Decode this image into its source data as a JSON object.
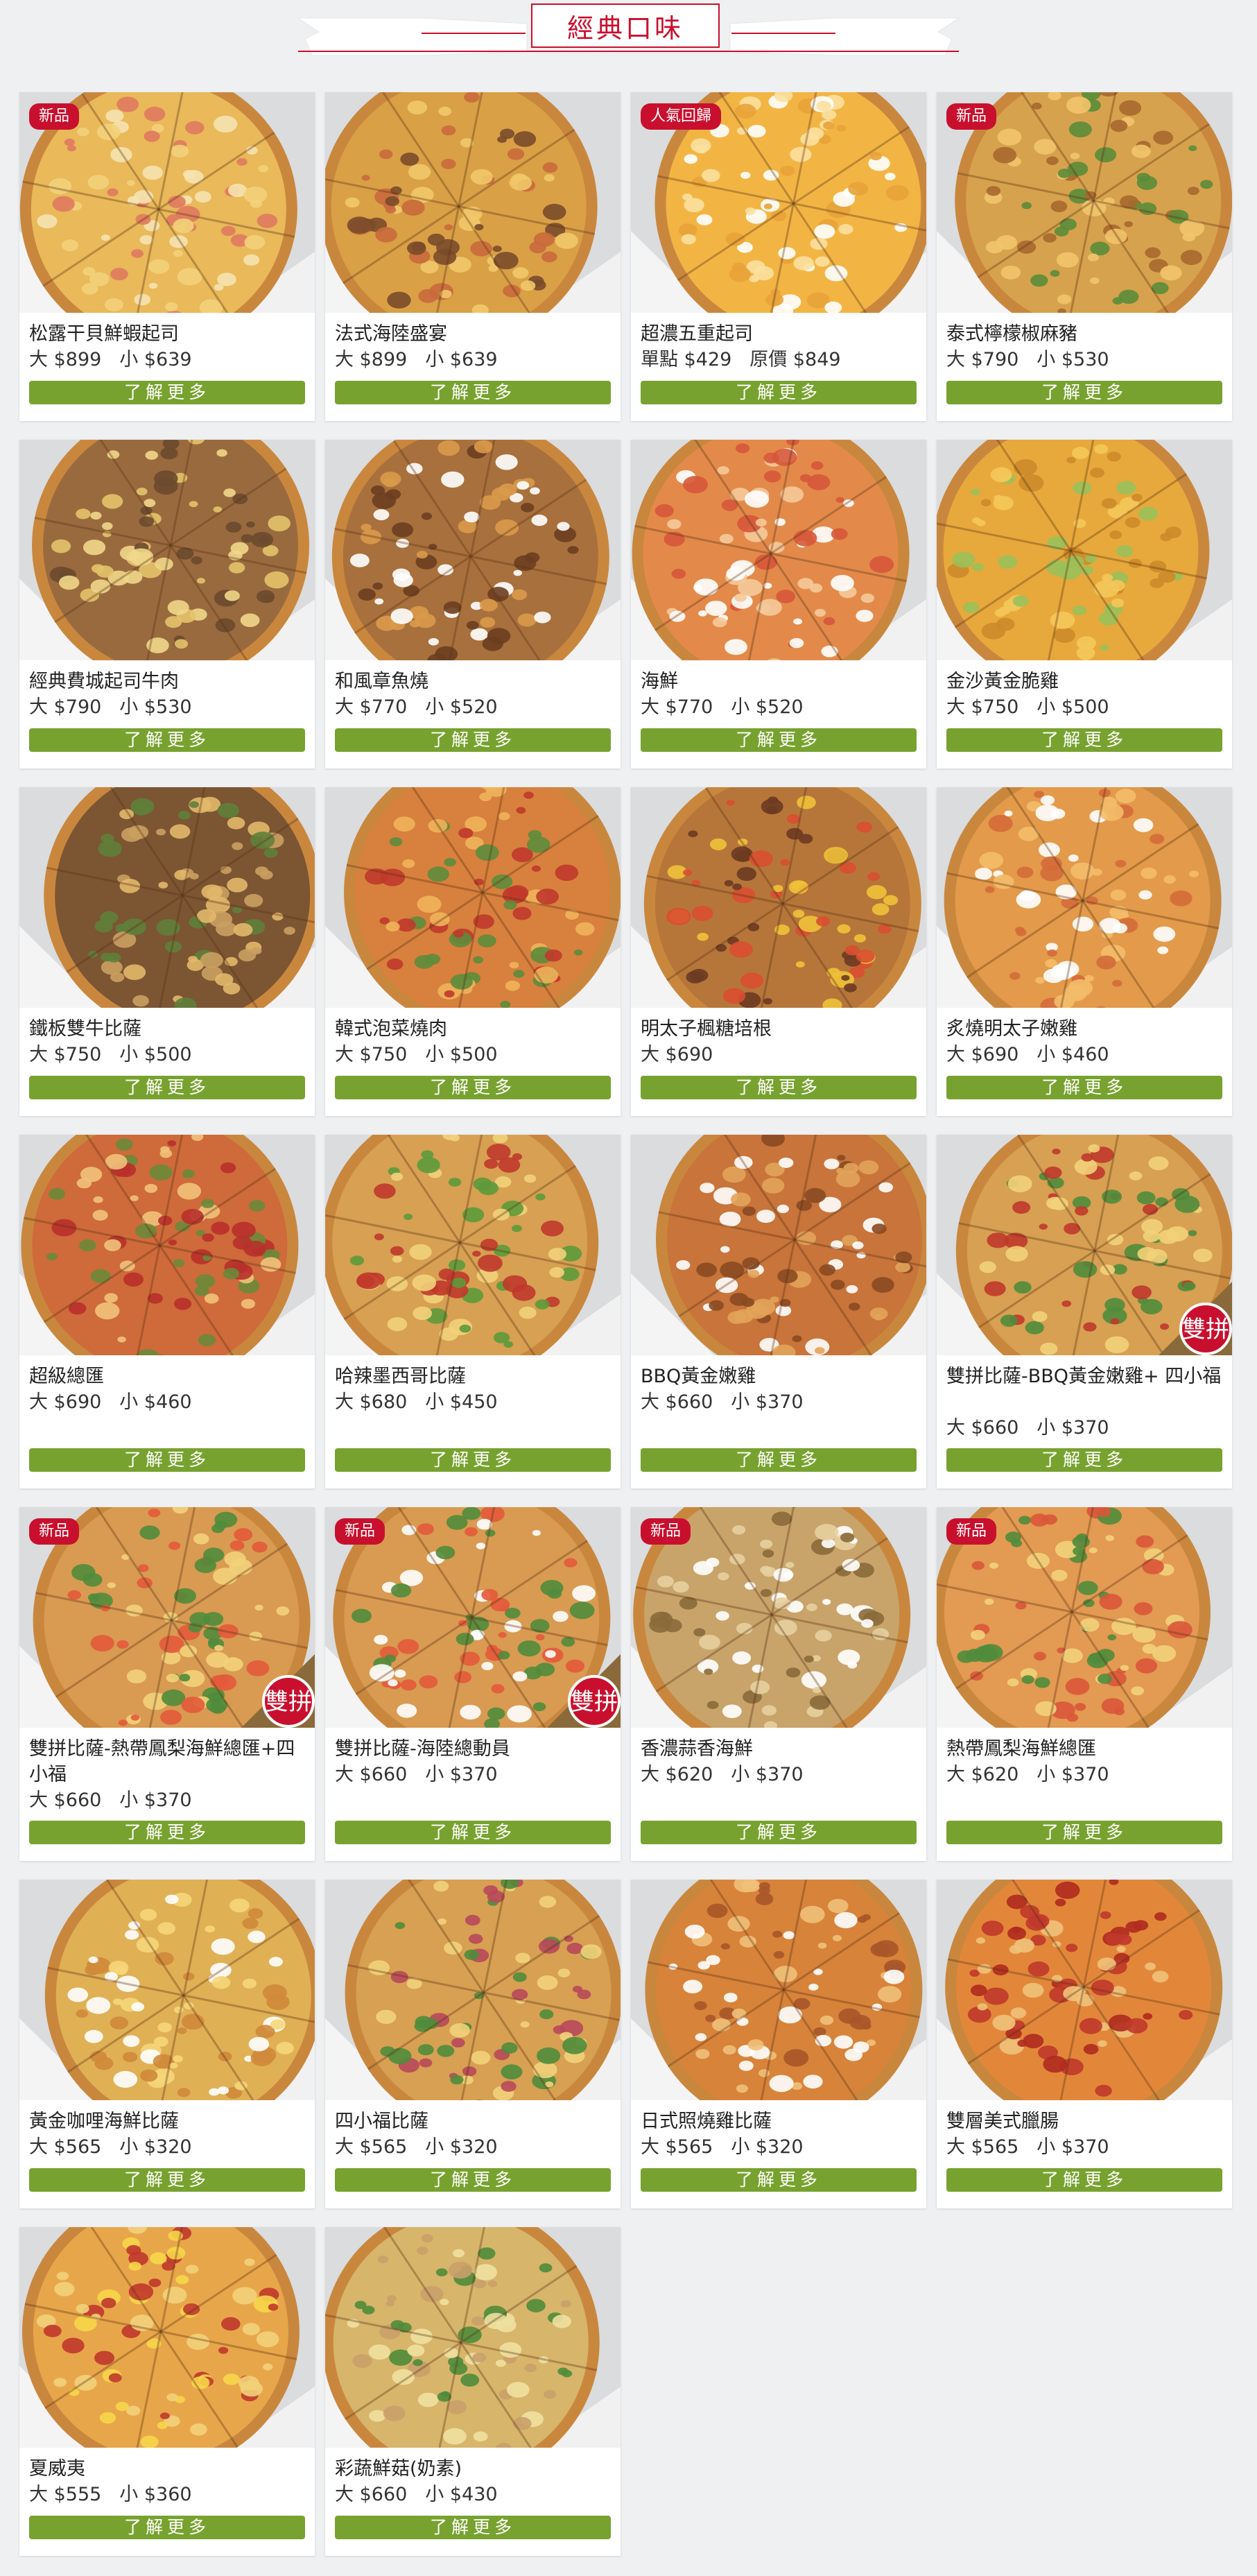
{
  "section": {
    "title": "經典口味"
  },
  "colors": {
    "brand_red": "#c8102e",
    "button_green": "#78a22f",
    "page_bg": "#eef0f1"
  },
  "button_label": "了解更多",
  "items": [
    {
      "name": "松露干貝鮮蝦起司",
      "price_a": "大 $899",
      "price_b": "小 $639",
      "badge": "新品",
      "duo": false
    },
    {
      "name": "法式海陸盛宴",
      "price_a": "大 $899",
      "price_b": "小 $639",
      "badge": "",
      "duo": false
    },
    {
      "name": "超濃五重起司",
      "price_a": "單點 $429",
      "price_b": "原價 $849",
      "badge": "人氣回歸",
      "duo": false
    },
    {
      "name": "泰式檸檬椒麻豬",
      "price_a": "大 $790",
      "price_b": "小 $530",
      "badge": "新品",
      "duo": false
    },
    {
      "name": "經典費城起司牛肉",
      "price_a": "大 $790",
      "price_b": "小 $530",
      "badge": "",
      "duo": false
    },
    {
      "name": "和風章魚燒",
      "price_a": "大 $770",
      "price_b": "小 $520",
      "badge": "",
      "duo": false
    },
    {
      "name": "海鮮",
      "price_a": "大 $770",
      "price_b": "小 $520",
      "badge": "",
      "duo": false
    },
    {
      "name": "金沙黃金脆雞",
      "price_a": "大 $750",
      "price_b": "小 $500",
      "badge": "",
      "duo": false
    },
    {
      "name": "鐵板雙牛比薩",
      "price_a": "大 $750",
      "price_b": "小 $500",
      "badge": "",
      "duo": false
    },
    {
      "name": "韓式泡菜燒肉",
      "price_a": "大 $750",
      "price_b": "小 $500",
      "badge": "",
      "duo": false
    },
    {
      "name": "明太子楓糖培根",
      "price_a": "大 $690",
      "price_b": "",
      "badge": "",
      "duo": false
    },
    {
      "name": "炙燒明太子嫩雞",
      "price_a": "大 $690",
      "price_b": "小 $460",
      "badge": "",
      "duo": false
    },
    {
      "name": "超級總匯",
      "price_a": "大 $690",
      "price_b": "小 $460",
      "badge": "",
      "duo": false
    },
    {
      "name": "哈辣墨西哥比薩",
      "price_a": "大 $680",
      "price_b": "小 $450",
      "badge": "",
      "duo": false
    },
    {
      "name": "BBQ黃金嫩雞",
      "price_a": "大 $660",
      "price_b": "小 $370",
      "badge": "",
      "duo": false
    },
    {
      "name": "雙拼比薩-BBQ黃金嫩雞+ 四小福",
      "price_a": "大 $660",
      "price_b": "小 $370",
      "badge": "",
      "duo": true
    },
    {
      "name": "雙拼比薩-熱帶鳳梨海鮮總匯+四小福",
      "price_a": "大 $660",
      "price_b": "小 $370",
      "badge": "新品",
      "duo": true
    },
    {
      "name": "雙拼比薩-海陸總動員",
      "price_a": "大 $660",
      "price_b": "小 $370",
      "badge": "新品",
      "duo": true
    },
    {
      "name": "香濃蒜香海鮮",
      "price_a": "大 $620",
      "price_b": "小 $370",
      "badge": "新品",
      "duo": false
    },
    {
      "name": "熱帶鳳梨海鮮總匯",
      "price_a": "大 $620",
      "price_b": "小 $370",
      "badge": "新品",
      "duo": false
    },
    {
      "name": "黃金咖哩海鮮比薩",
      "price_a": "大 $565",
      "price_b": "小 $320",
      "badge": "",
      "duo": false
    },
    {
      "name": "四小福比薩",
      "price_a": "大 $565",
      "price_b": "小 $320",
      "badge": "",
      "duo": false
    },
    {
      "name": "日式照燒雞比薩",
      "price_a": "大 $565",
      "price_b": "小 $320",
      "badge": "",
      "duo": false
    },
    {
      "name": "雙層美式臘腸",
      "price_a": "大 $565",
      "price_b": "小 $370",
      "badge": "",
      "duo": false
    },
    {
      "name": "夏威夷",
      "price_a": "大 $555",
      "price_b": "小 $360",
      "badge": "",
      "duo": false
    },
    {
      "name": "彩蔬鮮菇(奶素)",
      "price_a": "大 $660",
      "price_b": "小 $430",
      "badge": "",
      "duo": false
    }
  ]
}
